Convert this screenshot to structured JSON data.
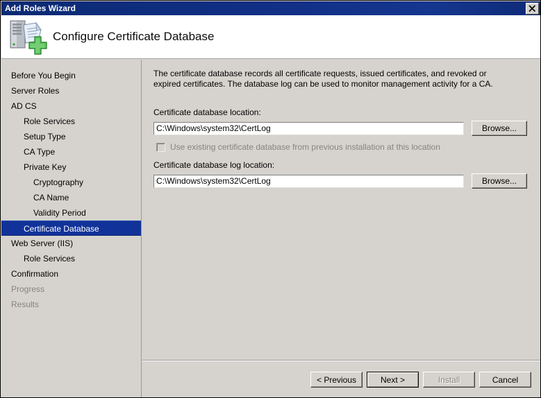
{
  "window": {
    "title": "Add Roles Wizard",
    "close_icon": "close-icon"
  },
  "header": {
    "title": "Configure Certificate Database",
    "icon": "server-certificate-add-icon"
  },
  "sidebar": {
    "items": [
      {
        "label": "Before You Begin",
        "level": 0,
        "state": "normal"
      },
      {
        "label": "Server Roles",
        "level": 0,
        "state": "normal"
      },
      {
        "label": "AD CS",
        "level": 0,
        "state": "normal"
      },
      {
        "label": "Role Services",
        "level": 1,
        "state": "normal"
      },
      {
        "label": "Setup Type",
        "level": 1,
        "state": "normal"
      },
      {
        "label": "CA Type",
        "level": 1,
        "state": "normal"
      },
      {
        "label": "Private Key",
        "level": 1,
        "state": "normal"
      },
      {
        "label": "Cryptography",
        "level": 2,
        "state": "normal"
      },
      {
        "label": "CA Name",
        "level": 2,
        "state": "normal"
      },
      {
        "label": "Validity Period",
        "level": 2,
        "state": "normal"
      },
      {
        "label": "Certificate Database",
        "level": 1,
        "state": "selected"
      },
      {
        "label": "Web Server (IIS)",
        "level": 0,
        "state": "normal"
      },
      {
        "label": "Role Services",
        "level": 1,
        "state": "normal"
      },
      {
        "label": "Confirmation",
        "level": 0,
        "state": "normal"
      },
      {
        "label": "Progress",
        "level": 0,
        "state": "disabled"
      },
      {
        "label": "Results",
        "level": 0,
        "state": "disabled"
      }
    ]
  },
  "content": {
    "description": "The certificate database records all certificate requests, issued certificates, and revoked or expired certificates. The database log can be used to monitor management activity for a CA.",
    "database_location_label": "Certificate database location:",
    "database_location_value": "C:\\Windows\\system32\\CertLog",
    "database_browse_label": "Browse...",
    "use_existing_label": "Use existing certificate database from previous installation at this location",
    "use_existing_checked": false,
    "log_location_label": "Certificate database log location:",
    "log_location_value": "C:\\Windows\\system32\\CertLog",
    "log_browse_label": "Browse..."
  },
  "footer": {
    "previous_label": "< Previous",
    "next_label": "Next >",
    "install_label": "Install",
    "cancel_label": "Cancel"
  },
  "colors": {
    "titlebar": "#123087",
    "selection": "#113399",
    "face": "#d6d3ce",
    "disabled_text": "#878480"
  }
}
